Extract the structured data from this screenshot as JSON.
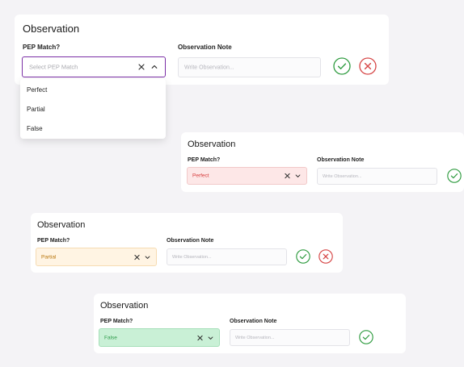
{
  "colors": {
    "purple_focus": "#7b2fa6",
    "green_check": "#2e9b3f",
    "red_close": "#d64545",
    "perfect_bg": "#fde7e7",
    "perfect_text": "#d63b3b",
    "partial_bg": "#fff4e3",
    "partial_text": "#b9770e",
    "false_bg": "#c9f0d6",
    "false_text": "#2e9b4a"
  },
  "card1": {
    "title": "Observation",
    "pep_label": "PEP Match?",
    "select_placeholder": "Select PEP Match",
    "note_label": "Observation Note",
    "note_placeholder": "Write Observation...",
    "icons": [
      "close-icon",
      "chevron-up-icon",
      "check-circle-icon",
      "close-circle-icon"
    ],
    "dropdown_options": [
      "Perfect",
      "Partial",
      "False"
    ]
  },
  "card2": {
    "title": "Observation",
    "pep_label": "PEP Match?",
    "select_value": "Perfect",
    "note_label": "Observation Note",
    "note_placeholder": "Write Observation...",
    "icons": [
      "close-icon",
      "chevron-down-icon",
      "check-circle-icon"
    ]
  },
  "card3": {
    "title": "Observation",
    "pep_label": "PEP Match?",
    "select_value": "Partial",
    "note_label": "Observation Note",
    "note_placeholder": "Write Observation...",
    "icons": [
      "close-icon",
      "chevron-down-icon",
      "check-circle-icon",
      "close-circle-icon"
    ]
  },
  "card4": {
    "title": "Observation",
    "pep_label": "PEP Match?",
    "select_value": "False",
    "note_label": "Observation Note",
    "note_placeholder": "Write Observation...",
    "icons": [
      "close-icon",
      "chevron-down-icon",
      "check-circle-icon"
    ]
  }
}
